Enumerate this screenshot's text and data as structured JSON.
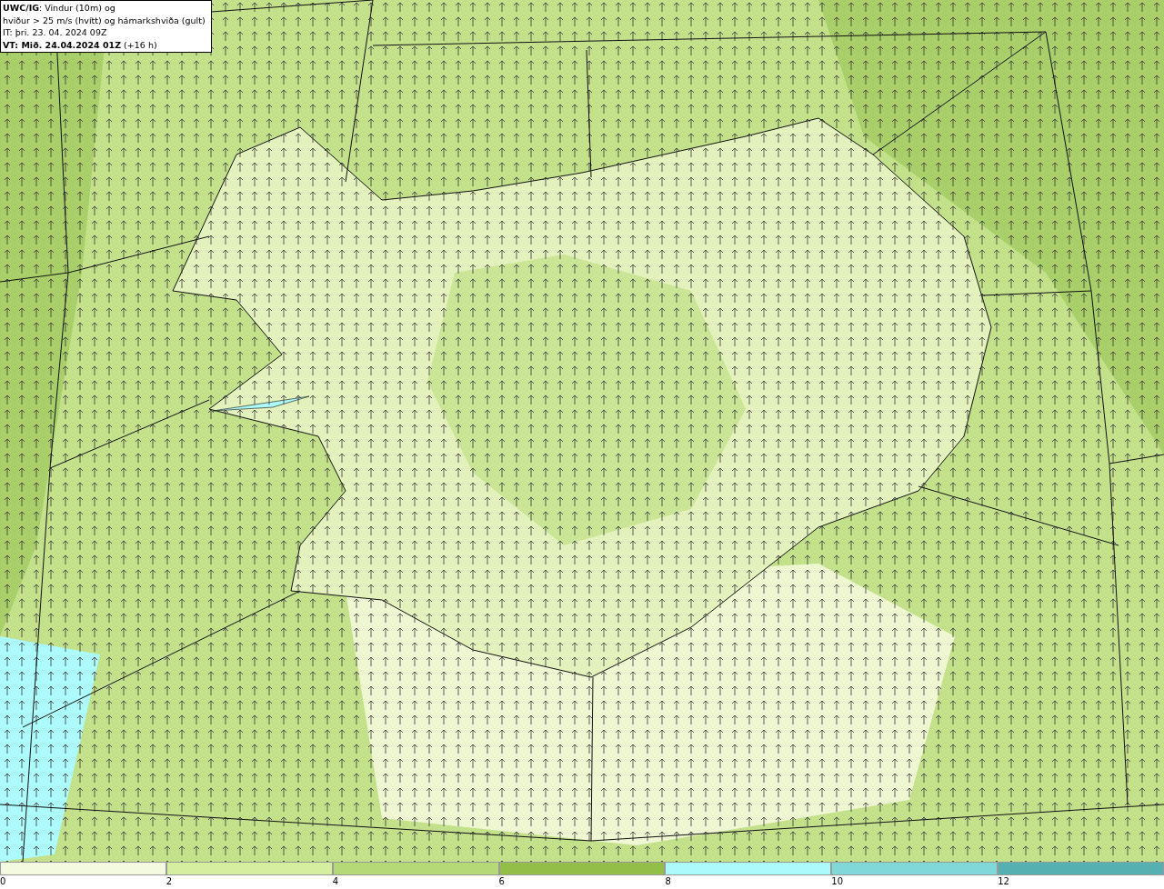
{
  "title_box": {
    "lines": [
      "**UWC/IG**: Vindur (10m) og",
      "hviður > 25 m/s (hvítt) og hámarkshviða (gult)",
      "IT: þri. 23. 04. 2024 09Z",
      "**VT: Mið. 24.04.2024 01Z** (+16 h)"
    ]
  },
  "legend": {
    "bins": [
      {
        "label": "0",
        "color": "#f4fadf"
      },
      {
        "label": "2",
        "color": "#d6eea0"
      },
      {
        "label": "4",
        "color": "#b6d977"
      },
      {
        "label": "6",
        "color": "#93be48"
      },
      {
        "label": "8",
        "color": "#adfafa"
      },
      {
        "label": "10",
        "color": "#80d8d8"
      },
      {
        "label": "12",
        "color": "#55b1b1"
      }
    ]
  }
}
